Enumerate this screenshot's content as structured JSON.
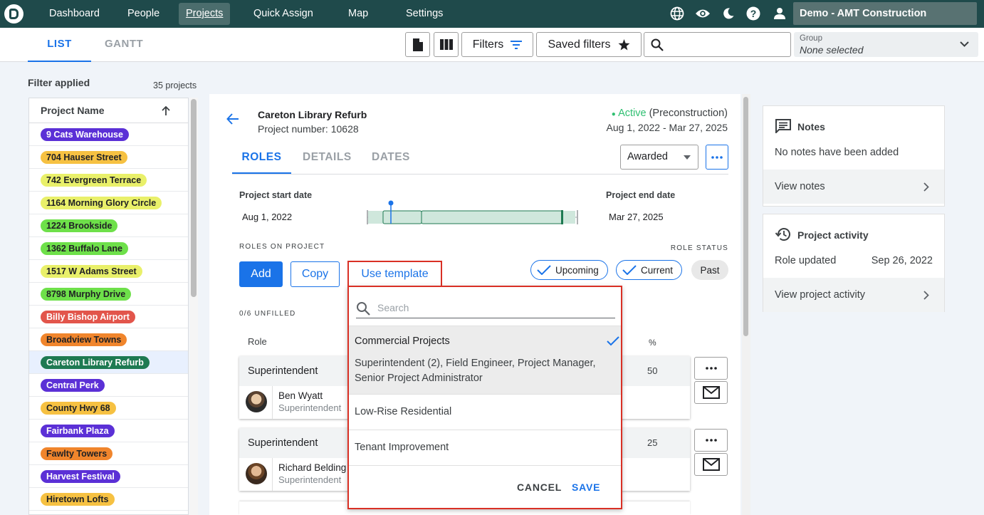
{
  "nav": {
    "items": [
      "Dashboard",
      "People",
      "Projects",
      "Quick Assign",
      "Map",
      "Settings"
    ],
    "active": "Projects",
    "org_name": "Demo - AMT Construction"
  },
  "subbar": {
    "tabs": [
      "LIST",
      "GANTT"
    ],
    "filters_label": "Filters",
    "saved_filters_label": "Saved filters",
    "search_placeholder": "",
    "group_label": "Group",
    "group_value": "None selected"
  },
  "project_list": {
    "filter_applied": "Filter applied",
    "count": "35 projects",
    "header": "Project Name",
    "projects": [
      {
        "name": "9 Cats Warehouse",
        "bg": "#5b30d6",
        "fg": "#ffffff"
      },
      {
        "name": "704 Hauser Street",
        "bg": "#f6c142",
        "fg": "#202124"
      },
      {
        "name": "742 Evergreen Terrace",
        "bg": "#e9f06a",
        "fg": "#202124"
      },
      {
        "name": "1164 Morning Glory Circle",
        "bg": "#e9f06a",
        "fg": "#202124"
      },
      {
        "name": "1224 Brookside",
        "bg": "#6ee04a",
        "fg": "#202124"
      },
      {
        "name": "1362 Buffalo Lane",
        "bg": "#6ee04a",
        "fg": "#202124"
      },
      {
        "name": "1517 W Adams Street",
        "bg": "#e9f06a",
        "fg": "#202124"
      },
      {
        "name": "8798 Murphy Drive",
        "bg": "#6ee04a",
        "fg": "#202124"
      },
      {
        "name": "Billy Bishop Airport",
        "bg": "#e2554b",
        "fg": "#ffffff"
      },
      {
        "name": "Broadview Towns",
        "bg": "#f0852c",
        "fg": "#202124"
      },
      {
        "name": "Careton Library Refurb",
        "bg": "#1e7a52",
        "fg": "#ffffff"
      },
      {
        "name": "Central Perk",
        "bg": "#5b30d6",
        "fg": "#ffffff"
      },
      {
        "name": "County Hwy 68",
        "bg": "#f6c142",
        "fg": "#202124"
      },
      {
        "name": "Fairbank Plaza",
        "bg": "#5b30d6",
        "fg": "#ffffff"
      },
      {
        "name": "Fawlty Towers",
        "bg": "#f0852c",
        "fg": "#202124"
      },
      {
        "name": "Harvest Festival",
        "bg": "#5b30d6",
        "fg": "#ffffff"
      },
      {
        "name": "Hiretown Lofts",
        "bg": "#f6c142",
        "fg": "#202124"
      }
    ],
    "selected": "Careton Library Refurb"
  },
  "detail": {
    "title": "Careton Library Refurb",
    "project_number": "Project number: 10628",
    "status": "Active",
    "status_phase": "(Preconstruction)",
    "date_range": "Aug 1, 2022 - Mar 27, 2025",
    "tabs": [
      "ROLES",
      "DETAILS",
      "DATES"
    ],
    "stage_value": "Awarded",
    "start_label": "Project start date",
    "start_date": "Aug 1, 2022",
    "end_label": "Project end date",
    "end_date": "Mar 27, 2025",
    "roles_heading": "ROLES ON PROJECT",
    "role_status_heading": "ROLE STATUS",
    "add_label": "Add",
    "copy_label": "Copy",
    "template_label": "Use template",
    "status_pills": [
      "Upcoming",
      "Current",
      "Past"
    ],
    "unfilled": "0/6 UNFILLED",
    "role_col": "Role",
    "pct_col": "%",
    "roles": [
      {
        "role": "Superintendent",
        "person": "Ben Wyatt",
        "person_role": "Superintendent",
        "pct": "50"
      },
      {
        "role": "Superintendent",
        "person": "Richard Belding",
        "person_role": "Superintendent",
        "pct": "25"
      }
    ]
  },
  "template_dropdown": {
    "search_placeholder": "Search",
    "items": [
      {
        "name": "Commercial Projects",
        "detail": "Superintendent (2), Field Engineer, Project Manager, Senior Project Administrator",
        "selected": true
      },
      {
        "name": "Low-Rise Residential"
      },
      {
        "name": "Tenant Improvement"
      }
    ],
    "cancel": "CANCEL",
    "save": "SAVE"
  },
  "right_panel": {
    "notes_title": "Notes",
    "notes_empty": "No notes have been added",
    "view_notes": "View notes",
    "activity_title": "Project activity",
    "activity_item": "Role updated",
    "activity_date": "Sep 26, 2022",
    "view_activity": "View project activity"
  },
  "colors": {
    "nav_bg": "#1f4a4b",
    "accent": "#1a73e8",
    "active_status": "#2fbf71",
    "highlight_border": "#d93025"
  }
}
